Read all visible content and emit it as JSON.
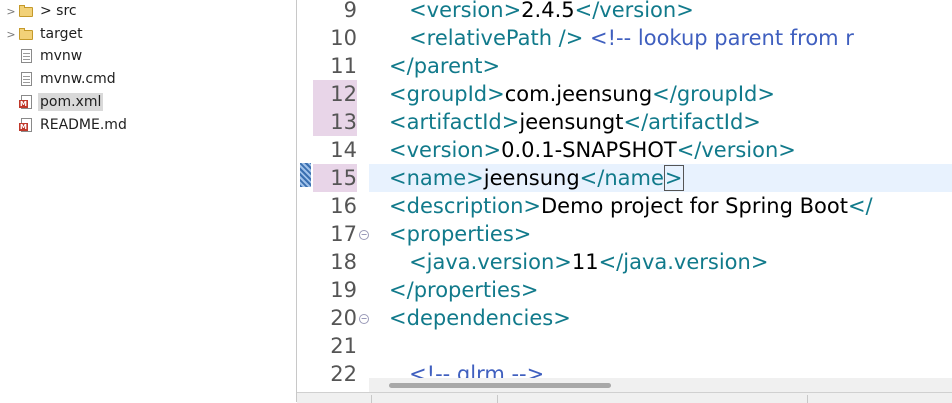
{
  "explorer": {
    "items": [
      {
        "label": "> src",
        "icon": "folder-icon",
        "twisty": ">"
      },
      {
        "label": "target",
        "icon": "folder-icon",
        "twisty": ">"
      },
      {
        "label": "mvnw",
        "icon": "file-icon",
        "twisty": ""
      },
      {
        "label": "mvnw.cmd",
        "icon": "file-icon",
        "twisty": ""
      },
      {
        "label": "pom.xml",
        "icon": "xml-icon",
        "twisty": "",
        "selected": true
      },
      {
        "label": "README.md",
        "icon": "xml-icon",
        "twisty": ""
      }
    ]
  },
  "editor": {
    "lines": [
      {
        "num": "9",
        "parts": [
          [
            "indent",
            "      "
          ],
          [
            "tag",
            "<version>"
          ],
          [
            "txt",
            "2.4.5"
          ],
          [
            "tag",
            "</version>"
          ]
        ]
      },
      {
        "num": "10",
        "parts": [
          [
            "indent",
            "      "
          ],
          [
            "tag",
            "<relativePath />"
          ],
          [
            "txt",
            " "
          ],
          [
            "cmt",
            "<!-- lookup parent from r"
          ]
        ]
      },
      {
        "num": "11",
        "parts": [
          [
            "indent",
            "   "
          ],
          [
            "tag",
            "</parent>"
          ]
        ]
      },
      {
        "num": "12",
        "highlight": true,
        "parts": [
          [
            "indent",
            "   "
          ],
          [
            "tag",
            "<groupId>"
          ],
          [
            "txt",
            "com.jeensung"
          ],
          [
            "tag",
            "</groupId>"
          ]
        ]
      },
      {
        "num": "13",
        "highlight": true,
        "parts": [
          [
            "indent",
            "   "
          ],
          [
            "tag",
            "<artifactId>"
          ],
          [
            "txt",
            "jeensungt"
          ],
          [
            "tag",
            "</artifactId>"
          ]
        ]
      },
      {
        "num": "14",
        "parts": [
          [
            "indent",
            "   "
          ],
          [
            "tag",
            "<version>"
          ],
          [
            "txt",
            "0.0.1-SNAPSHOT"
          ],
          [
            "tag",
            "</version>"
          ]
        ]
      },
      {
        "num": "15",
        "highlight": true,
        "current": true,
        "parts": [
          [
            "indent",
            "   "
          ],
          [
            "tag",
            "<name>"
          ],
          [
            "txt",
            "jeensung"
          ],
          [
            "tag",
            "</name>"
          ]
        ]
      },
      {
        "num": "16",
        "parts": [
          [
            "indent",
            "   "
          ],
          [
            "tag",
            "<description>"
          ],
          [
            "txt",
            "Demo project for Spring Boot"
          ],
          [
            "tag",
            "</"
          ]
        ]
      },
      {
        "num": "17",
        "fold": true,
        "parts": [
          [
            "indent",
            "   "
          ],
          [
            "tag",
            "<properties>"
          ]
        ]
      },
      {
        "num": "18",
        "parts": [
          [
            "indent",
            "      "
          ],
          [
            "tag",
            "<java.version>"
          ],
          [
            "txt",
            "11"
          ],
          [
            "tag",
            "</java.version>"
          ]
        ]
      },
      {
        "num": "19",
        "parts": [
          [
            "indent",
            "   "
          ],
          [
            "tag",
            "</properties>"
          ]
        ]
      },
      {
        "num": "20",
        "fold": true,
        "parts": [
          [
            "indent",
            "   "
          ],
          [
            "tag",
            "<dependencies>"
          ]
        ]
      },
      {
        "num": "21",
        "parts": []
      },
      {
        "num": "22",
        "parts": [
          [
            "indent",
            "      "
          ],
          [
            "cmt",
            "<!-- glrm -->"
          ]
        ]
      }
    ]
  },
  "colors": {
    "tag": "#117a8b",
    "comment": "#3f5fbf",
    "current_line": "#e8f2fe",
    "line_highlight": "#e8d5e8"
  }
}
